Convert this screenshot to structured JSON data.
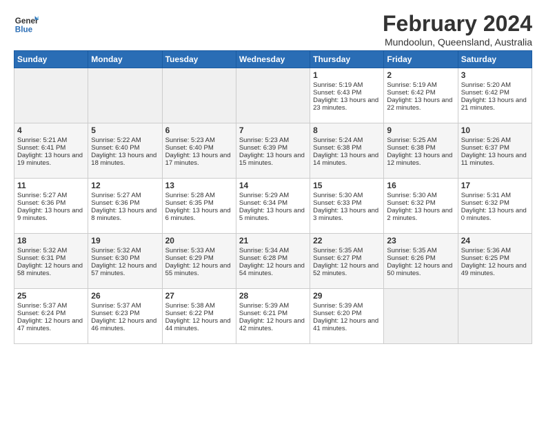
{
  "header": {
    "logo_general": "General",
    "logo_blue": "Blue",
    "title": "February 2024",
    "location": "Mundoolun, Queensland, Australia"
  },
  "weekdays": [
    "Sunday",
    "Monday",
    "Tuesday",
    "Wednesday",
    "Thursday",
    "Friday",
    "Saturday"
  ],
  "weeks": [
    [
      {
        "day": "",
        "empty": true
      },
      {
        "day": "",
        "empty": true
      },
      {
        "day": "",
        "empty": true
      },
      {
        "day": "",
        "empty": true
      },
      {
        "day": "1",
        "sunrise": "5:19 AM",
        "sunset": "6:43 PM",
        "daylight": "13 hours and 23 minutes."
      },
      {
        "day": "2",
        "sunrise": "5:19 AM",
        "sunset": "6:42 PM",
        "daylight": "13 hours and 22 minutes."
      },
      {
        "day": "3",
        "sunrise": "5:20 AM",
        "sunset": "6:42 PM",
        "daylight": "13 hours and 21 minutes."
      }
    ],
    [
      {
        "day": "4",
        "sunrise": "5:21 AM",
        "sunset": "6:41 PM",
        "daylight": "13 hours and 19 minutes."
      },
      {
        "day": "5",
        "sunrise": "5:22 AM",
        "sunset": "6:40 PM",
        "daylight": "13 hours and 18 minutes."
      },
      {
        "day": "6",
        "sunrise": "5:23 AM",
        "sunset": "6:40 PM",
        "daylight": "13 hours and 17 minutes."
      },
      {
        "day": "7",
        "sunrise": "5:23 AM",
        "sunset": "6:39 PM",
        "daylight": "13 hours and 15 minutes."
      },
      {
        "day": "8",
        "sunrise": "5:24 AM",
        "sunset": "6:38 PM",
        "daylight": "13 hours and 14 minutes."
      },
      {
        "day": "9",
        "sunrise": "5:25 AM",
        "sunset": "6:38 PM",
        "daylight": "13 hours and 12 minutes."
      },
      {
        "day": "10",
        "sunrise": "5:26 AM",
        "sunset": "6:37 PM",
        "daylight": "13 hours and 11 minutes."
      }
    ],
    [
      {
        "day": "11",
        "sunrise": "5:27 AM",
        "sunset": "6:36 PM",
        "daylight": "13 hours and 9 minutes."
      },
      {
        "day": "12",
        "sunrise": "5:27 AM",
        "sunset": "6:36 PM",
        "daylight": "13 hours and 8 minutes."
      },
      {
        "day": "13",
        "sunrise": "5:28 AM",
        "sunset": "6:35 PM",
        "daylight": "13 hours and 6 minutes."
      },
      {
        "day": "14",
        "sunrise": "5:29 AM",
        "sunset": "6:34 PM",
        "daylight": "13 hours and 5 minutes."
      },
      {
        "day": "15",
        "sunrise": "5:30 AM",
        "sunset": "6:33 PM",
        "daylight": "13 hours and 3 minutes."
      },
      {
        "day": "16",
        "sunrise": "5:30 AM",
        "sunset": "6:32 PM",
        "daylight": "13 hours and 2 minutes."
      },
      {
        "day": "17",
        "sunrise": "5:31 AM",
        "sunset": "6:32 PM",
        "daylight": "13 hours and 0 minutes."
      }
    ],
    [
      {
        "day": "18",
        "sunrise": "5:32 AM",
        "sunset": "6:31 PM",
        "daylight": "12 hours and 58 minutes."
      },
      {
        "day": "19",
        "sunrise": "5:32 AM",
        "sunset": "6:30 PM",
        "daylight": "12 hours and 57 minutes."
      },
      {
        "day": "20",
        "sunrise": "5:33 AM",
        "sunset": "6:29 PM",
        "daylight": "12 hours and 55 minutes."
      },
      {
        "day": "21",
        "sunrise": "5:34 AM",
        "sunset": "6:28 PM",
        "daylight": "12 hours and 54 minutes."
      },
      {
        "day": "22",
        "sunrise": "5:35 AM",
        "sunset": "6:27 PM",
        "daylight": "12 hours and 52 minutes."
      },
      {
        "day": "23",
        "sunrise": "5:35 AM",
        "sunset": "6:26 PM",
        "daylight": "12 hours and 50 minutes."
      },
      {
        "day": "24",
        "sunrise": "5:36 AM",
        "sunset": "6:25 PM",
        "daylight": "12 hours and 49 minutes."
      }
    ],
    [
      {
        "day": "25",
        "sunrise": "5:37 AM",
        "sunset": "6:24 PM",
        "daylight": "12 hours and 47 minutes."
      },
      {
        "day": "26",
        "sunrise": "5:37 AM",
        "sunset": "6:23 PM",
        "daylight": "12 hours and 46 minutes."
      },
      {
        "day": "27",
        "sunrise": "5:38 AM",
        "sunset": "6:22 PM",
        "daylight": "12 hours and 44 minutes."
      },
      {
        "day": "28",
        "sunrise": "5:39 AM",
        "sunset": "6:21 PM",
        "daylight": "12 hours and 42 minutes."
      },
      {
        "day": "29",
        "sunrise": "5:39 AM",
        "sunset": "6:20 PM",
        "daylight": "12 hours and 41 minutes."
      },
      {
        "day": "",
        "empty": true
      },
      {
        "day": "",
        "empty": true
      }
    ]
  ]
}
